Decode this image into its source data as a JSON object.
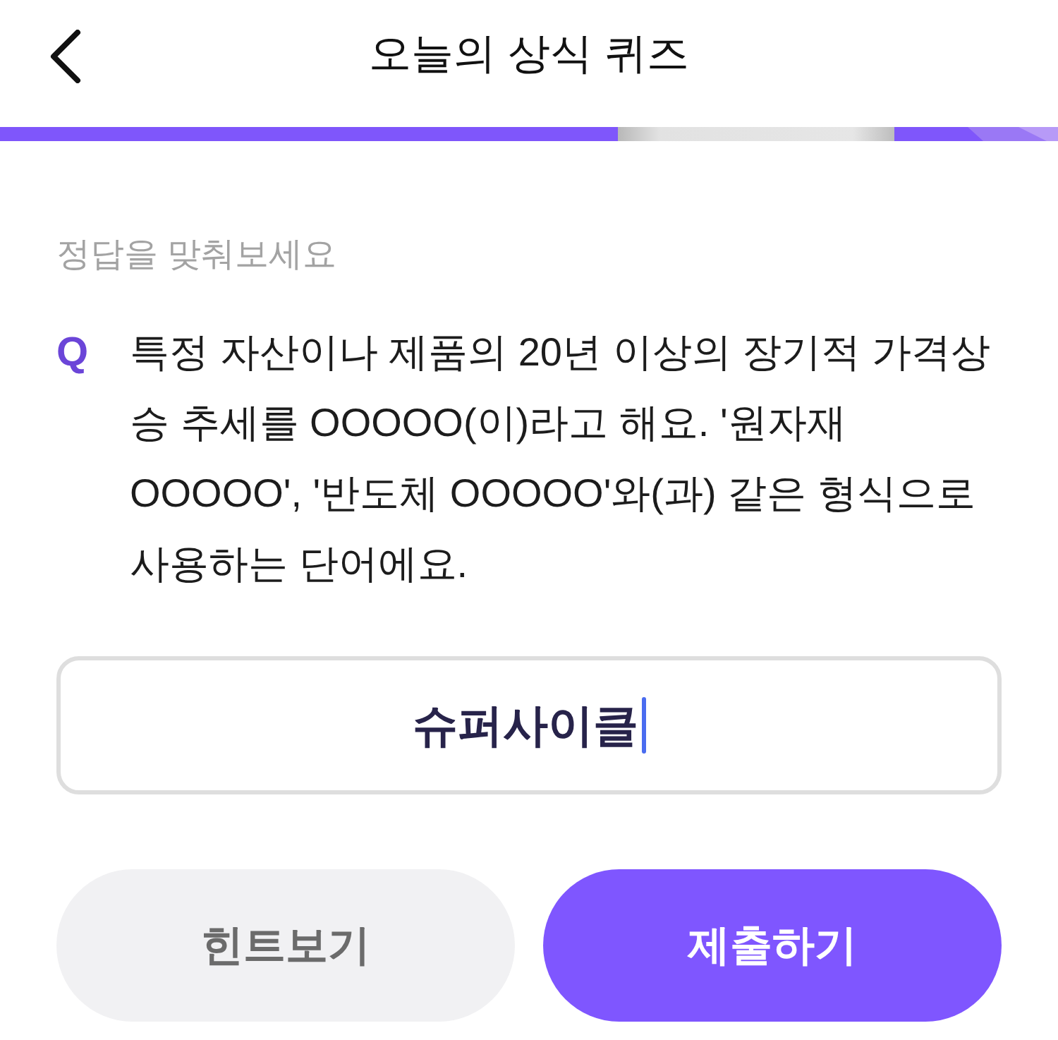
{
  "header": {
    "title": "오늘의 상식 퀴즈"
  },
  "prompt": "정답을 맞춰보세요",
  "question": {
    "marker": "Q",
    "text": "특정 자산이나 제품의 20년 이상의 장기적 가격상승 추세를 OOOOO(이)라고 해요. '원자재 OOOOO', '반도체 OOOOO'와(과) 같은 형식으로 사용하는 단어에요."
  },
  "answer": {
    "value": "슈퍼사이클",
    "focused": true
  },
  "buttons": [
    {
      "label": "힌트보기",
      "kind": "secondary"
    },
    {
      "label": "제출하기",
      "kind": "primary"
    }
  ]
}
